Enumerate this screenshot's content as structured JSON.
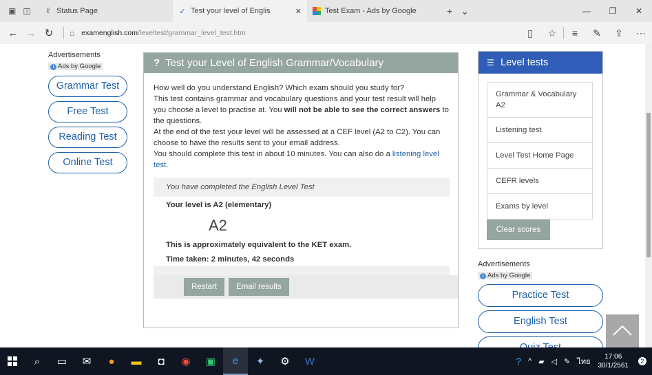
{
  "browser": {
    "tabs": [
      {
        "title": "Status Page",
        "active": false
      },
      {
        "title": "Test your level of Englis",
        "active": true,
        "close": "✕"
      },
      {
        "title": "Test Exam - Ads by Google",
        "active": false
      }
    ],
    "new_tab": "+",
    "tab_list": "⌄",
    "url_domain": "examenglish.com",
    "url_path": "/leveltest/grammar_level_test.htm"
  },
  "left_ads": {
    "title": "Advertisements",
    "ads_by": "Ads by Google",
    "buttons": [
      "Grammar Test",
      "Free Test",
      "Reading Test",
      "Online Test"
    ]
  },
  "main": {
    "heading_mark": "?",
    "heading": "Test your Level of English Grammar/Vocabulary",
    "para1": "How well do you understand English? Which exam should you study for?",
    "para2_a": "This test contains grammar and vocabulary questions and your test result will help you choose a level to practise at. You ",
    "para2_b": "will not be able to see the correct answers",
    "para2_c": " to the questions.",
    "para3": "At the end of the test your level will be assessed at a CEF level (A2 to C2). You can choose to have the results sent to your email address.",
    "para4_a": "You should complete this test in about 10 minutes. You can also do a ",
    "para4_link": "listening level test",
    "para4_c": ".",
    "completed": "You have completed the English Level Test",
    "level_line": "Your level is A2 (elementary)",
    "level_big": "A2",
    "equivalent": "This is approximately equivalent to the KET exam.",
    "time_taken": "Time taken: 2 minutes, 42 seconds",
    "restart": "Restart",
    "email": "Email results"
  },
  "level_tests": {
    "title": "Level tests",
    "items": [
      "Grammar & Vocabulary A2",
      "Listening test",
      "Level Test Home Page",
      "CEFR levels",
      "Exams by level"
    ],
    "clear": "Clear scores"
  },
  "right_ads": {
    "title": "Advertisements",
    "ads_by": "Ads by Google",
    "buttons": [
      "Practice Test",
      "English Test",
      "Quiz Test"
    ]
  },
  "taskbar": {
    "lang": "ไทย",
    "time": "17:06",
    "date": "30/1/2561",
    "notif_count": "2"
  }
}
